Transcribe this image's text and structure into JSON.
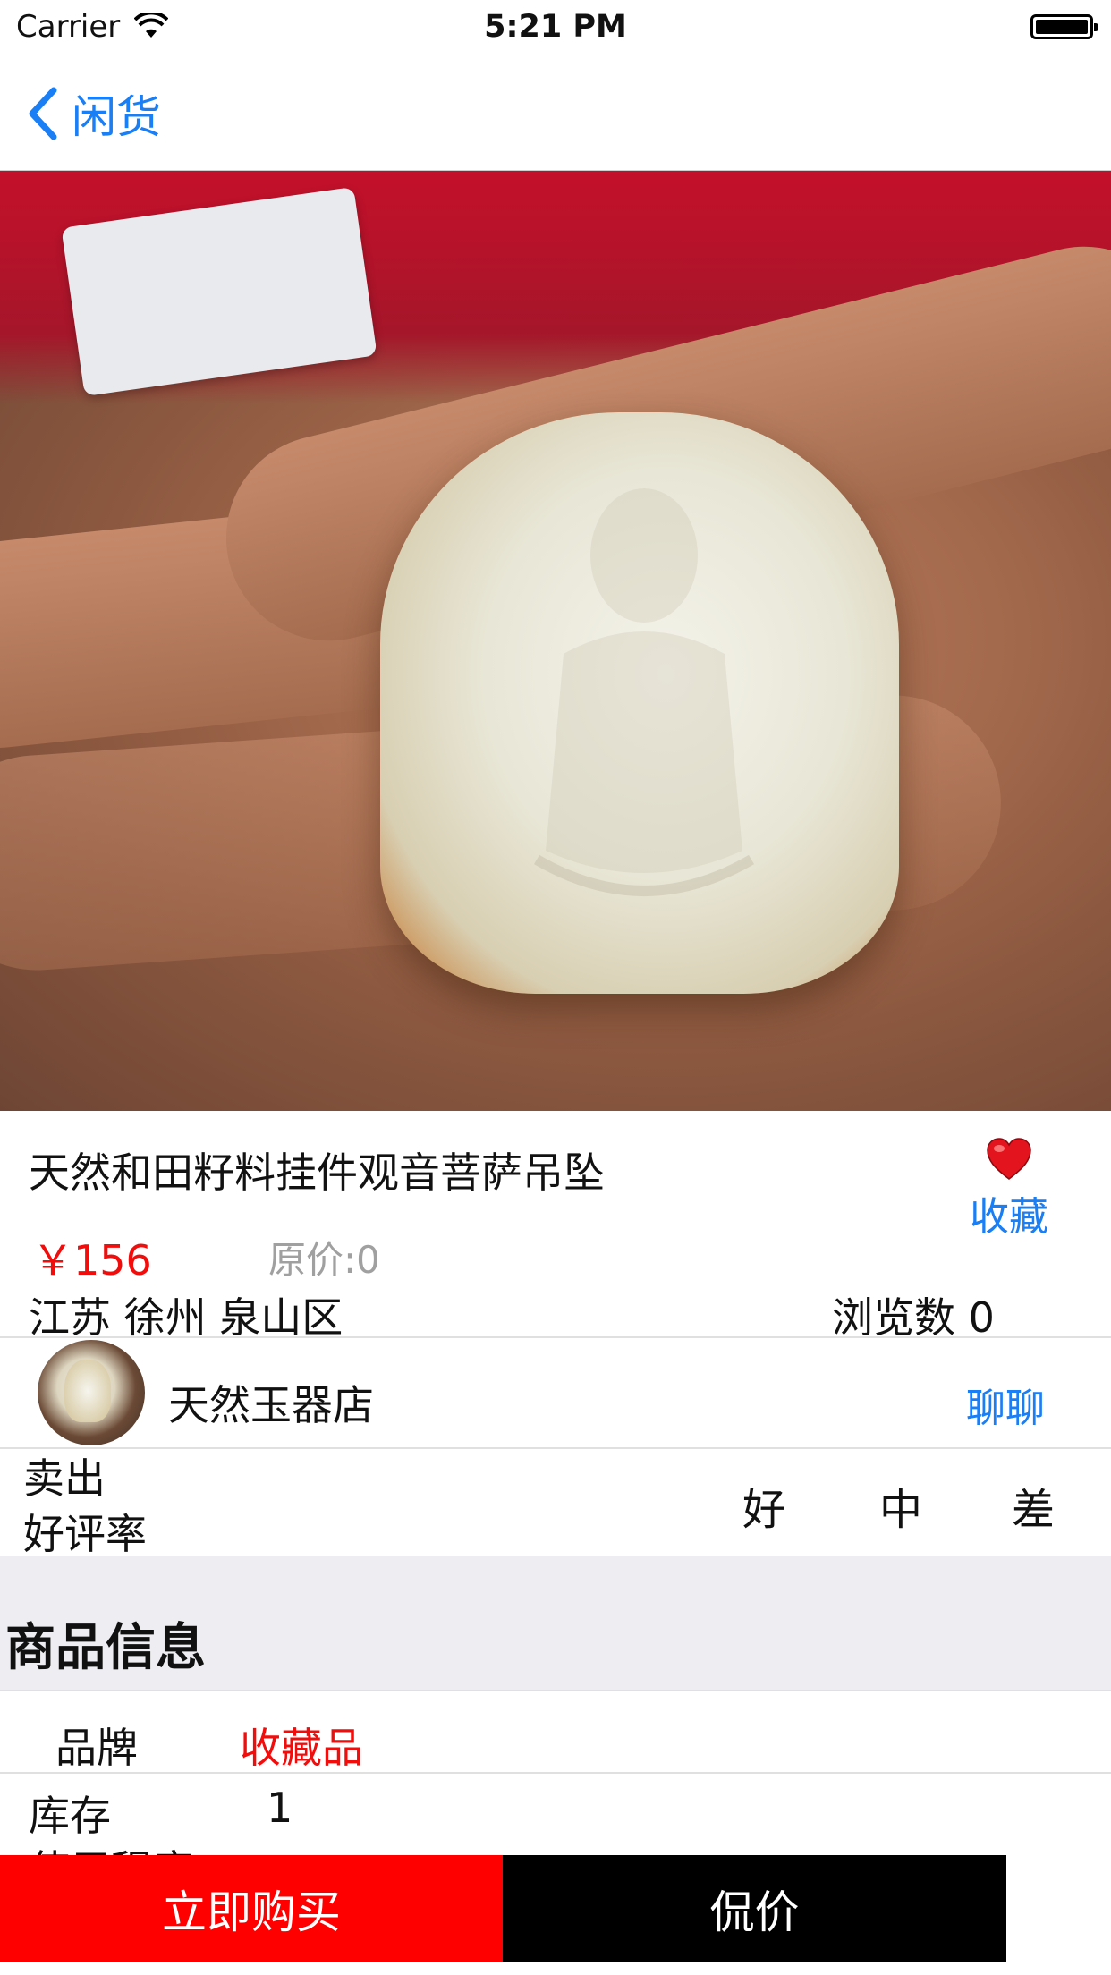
{
  "status_bar": {
    "carrier": "Carrier",
    "time": "5:21 PM"
  },
  "nav": {
    "back_label": "闲货"
  },
  "carousel": {
    "page_count": 2,
    "current_page": 1
  },
  "product": {
    "title": "天然和田籽料挂件观音菩萨吊坠",
    "favorite_label": "收藏",
    "price": "￥156",
    "original_price": "原价:0",
    "location": "江苏 徐州 泉山区",
    "views": "浏览数 0"
  },
  "seller": {
    "shop_name": "天然玉器店",
    "chat_label": "聊聊",
    "sold_label": "卖出",
    "rating_label": "好评率",
    "rating_good": "好",
    "rating_mid": "中",
    "rating_bad": "差"
  },
  "info_section": {
    "title": "商品信息",
    "brand_label": "品牌",
    "brand_value": "收藏品",
    "stock_label": "库存",
    "stock_value": "1",
    "usage_label": "使用程度"
  },
  "actions": {
    "buy_label": "立即购买",
    "bargain_label": "侃价"
  },
  "colors": {
    "accent_blue": "#1a7ef5",
    "price_red": "#f20d0d",
    "buy_red": "#ff0000",
    "bargain_black": "#000000"
  },
  "icons": [
    "wifi-icon",
    "battery-icon",
    "back-chevron-icon",
    "heart-icon"
  ]
}
